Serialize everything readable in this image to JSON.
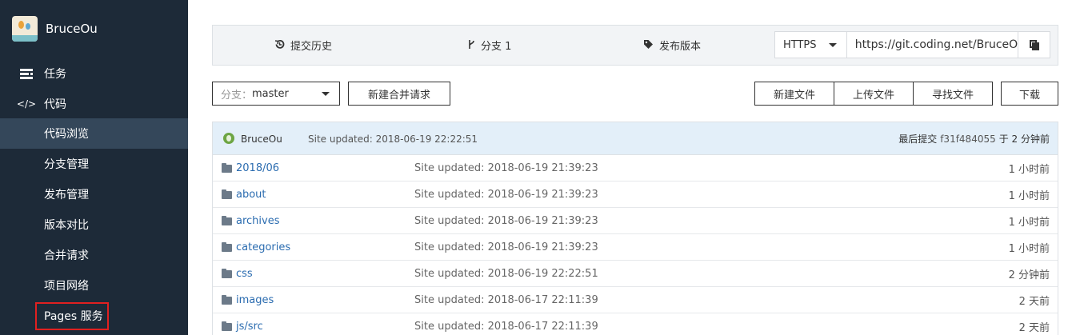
{
  "sidebar": {
    "project_name": "BruceOu",
    "nav_tasks": {
      "icon": "list-icon",
      "label": "任务"
    },
    "nav_code": {
      "icon": "code-icon",
      "label": "代码"
    },
    "sub_items": [
      {
        "label": "代码浏览",
        "active": true
      },
      {
        "label": "分支管理"
      },
      {
        "label": "发布管理"
      },
      {
        "label": "版本对比"
      },
      {
        "label": "合并请求"
      },
      {
        "label": "项目网络"
      },
      {
        "label": "Pages 服务",
        "highlighted": true
      }
    ]
  },
  "toolbar": {
    "history_label": "提交历史",
    "branch_label": "分支 1",
    "release_label": "发布版本",
    "clone_protocol": "HTTPS",
    "clone_url": "https://git.coding.net/BruceOu/BruceOu.git",
    "copy_icon": "copy-icon"
  },
  "actions": {
    "branch_prefix": "分支：",
    "branch_value": "master",
    "new_merge_request": "新建合并请求",
    "new_file": "新建文件",
    "upload_file": "上传文件",
    "find_file": "寻找文件",
    "download": "下载"
  },
  "commit": {
    "author": "BruceOu",
    "message": "Site updated: 2018-06-19 22:22:51",
    "latest_label": "最后提交",
    "hash": "f31f484055",
    "suffix": "于 2 分钟前"
  },
  "files": [
    {
      "name": "2018/06",
      "message": "Site updated: 2018-06-19 21:39:23",
      "time": "1 小时前"
    },
    {
      "name": "about",
      "message": "Site updated: 2018-06-19 21:39:23",
      "time": "1 小时前"
    },
    {
      "name": "archives",
      "message": "Site updated: 2018-06-19 21:39:23",
      "time": "1 小时前"
    },
    {
      "name": "categories",
      "message": "Site updated: 2018-06-19 21:39:23",
      "time": "1 小时前"
    },
    {
      "name": "css",
      "message": "Site updated: 2018-06-19 22:22:51",
      "time": "2 分钟前"
    },
    {
      "name": "images",
      "message": "Site updated: 2018-06-17 22:11:39",
      "time": "2 天前"
    },
    {
      "name": "js/src",
      "message": "Site updated: 2018-06-17 22:11:39",
      "time": "2 天前"
    }
  ],
  "colors": {
    "sidebar_bg": "#1d2a38",
    "sidebar_active": "#34475a",
    "highlight_border": "#e02020",
    "link": "#2b6cb0"
  }
}
